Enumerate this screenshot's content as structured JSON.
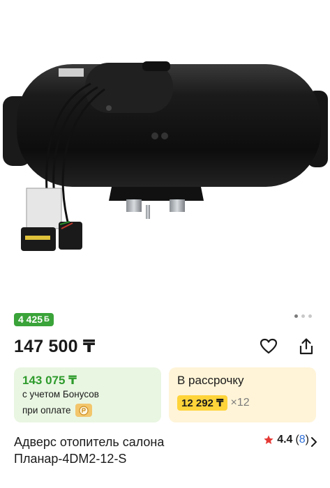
{
  "gallery": {
    "image_alt": "air heater product photo",
    "dots_count": 3,
    "active_dot": 0
  },
  "bonus_badge": {
    "amount": "4 425",
    "symbol": "Б"
  },
  "price": "147 500 ₸",
  "bonus_card": {
    "price": "143 075 ₸",
    "line1": "с учетом Бонусов",
    "line2": "при оплате"
  },
  "installment_card": {
    "title": "В рассрочку",
    "amount": "12 292 ₸",
    "multiplier": "×12"
  },
  "product": {
    "title": "Адверс отопитель салона Планар-4DM2-12-S"
  },
  "rating": {
    "value": "4.4",
    "open_paren": "(",
    "count": "8",
    "close_paren": ")"
  },
  "colors": {
    "bonus_green": "#3aa339",
    "install_yellow": "#ffd43a",
    "link_blue": "#2f6fd6",
    "star_red": "#e53935"
  },
  "icons": [
    "heart-icon",
    "share-icon",
    "star-icon",
    "chevron-right-icon",
    "pay-wallet-icon"
  ]
}
